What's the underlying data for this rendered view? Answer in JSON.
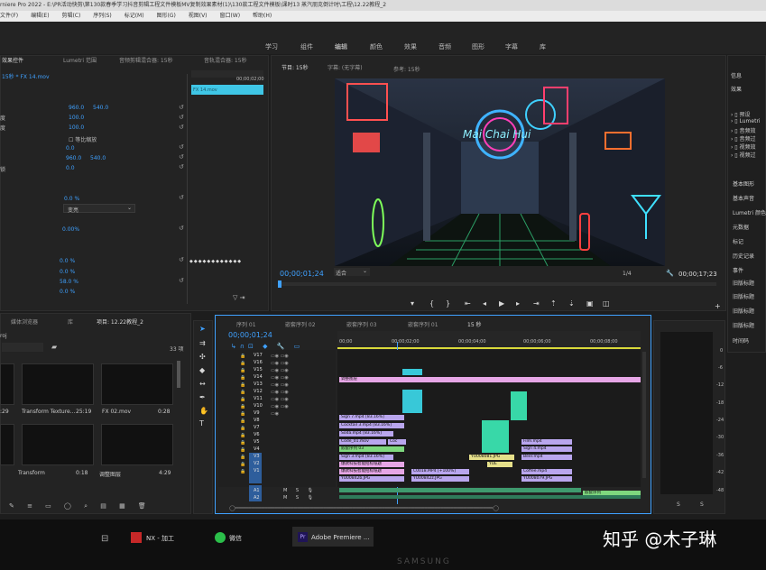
{
  "window": {
    "title": "rniere Pro 2022 - E:\\PR活动快剪\\第130款春季学习抖音剪辑工程文件模板MV复制效果素材(1)\\130款工程文件模板\\课时13 蒸汽朋克倒计时\\工程\\12.22教程_2",
    "menus": [
      "文件(F)",
      "编辑(E)",
      "剪辑(C)",
      "序列(S)",
      "标记(M)",
      "图形(G)",
      "视图(V)",
      "窗口(W)",
      "帮助(H)"
    ]
  },
  "workspaces": [
    "学习",
    "组件",
    "编辑",
    "颜色",
    "效果",
    "音频",
    "图形",
    "字幕",
    "库"
  ],
  "effect_controls": {
    "tabs": [
      "效果控件",
      "Lumetri 范围",
      "音频剪辑混合器: 15秒",
      "音轨混合器: 15秒"
    ],
    "clip": "15秒 * FX 14.mov",
    "mini_time": "00;00;02;00",
    "mini_clip": "FX 14.mov",
    "labels": [
      "度",
      "度",
      "等比缩放",
      "锁",
      ""
    ],
    "values": [
      {
        "a": "960.0",
        "b": "540.0"
      },
      {
        "a": "100.0",
        "b": ""
      },
      {
        "a": "100.0",
        "b": ""
      },
      {
        "a": "0.0",
        "b": ""
      },
      {
        "a": "960.0",
        "b": "540.0"
      },
      {
        "a": "0.0",
        "b": ""
      }
    ],
    "uniform_scale": "等比缩放",
    "pct1": "0.0 %",
    "blend_select": "变亮",
    "pct2": "0.00%",
    "pct3": "0.0 %",
    "pct4": "0.0 %",
    "pct5": "58.0 %",
    "pct6": "0.0 %"
  },
  "program": {
    "tabs": [
      "节目: 15秒",
      "字幕: (无字幕)",
      "参考: 15秒"
    ],
    "timecode": "00;00;01;24",
    "fit": "适合",
    "quality": "1/4",
    "duration": "00;00;17;23",
    "sign_text": "Mai Chai Hui"
  },
  "project": {
    "tabs": [
      "媒体浏览器",
      "库",
      "项目: 12.22教程_2"
    ],
    "name": "roj",
    "count": "33 项",
    "items": [
      {
        "name": "",
        "dur": ":29"
      },
      {
        "name": "Transform Texture...",
        "dur": "25:19"
      },
      {
        "name": "FX 02.mov",
        "dur": "0:28"
      },
      {
        "name": "",
        "dur": ""
      },
      {
        "name": "Transform",
        "dur": "0:18"
      },
      {
        "name": "调整图层",
        "dur": "4:29"
      }
    ]
  },
  "timeline": {
    "tabs": [
      "序列 01",
      "嵌套序列 02",
      "嵌套序列 03",
      "嵌套序列 01",
      "15 秒"
    ],
    "timecode": "00;00;01;24",
    "ruler": [
      "00;00",
      "00;00;02;00",
      "00;00;04;00",
      "00;00;06;00",
      "00;00;08;00"
    ],
    "video_tracks": [
      "V17",
      "V16",
      "V15",
      "V14",
      "V13",
      "V12",
      "V11",
      "V10",
      "V9",
      "V8",
      "V7",
      "V6",
      "V5",
      "V4",
      "V3",
      "V2",
      "V1"
    ],
    "audio_tracks": [
      "A1",
      "A2"
    ],
    "clips": [
      {
        "t": "调整图层",
        "c": "#e6a6e6"
      },
      {
        "t": "Sign 7.mp4 [83.16%]",
        "c": "#b9a6ee"
      },
      {
        "t": "Cocktail 3.mp4 [83.16%]",
        "c": "#b9a6ee"
      },
      {
        "t": "Soda.mp4 [83.16%]",
        "c": "#b9a6ee"
      },
      {
        "t": "Code_01.mov",
        "c": "#b9a6ee"
      },
      {
        "t": "Coc",
        "c": "#b9a6ee"
      },
      {
        "t": "嵌套序列 03",
        "c": "#7ed77e"
      },
      {
        "t": "Sign 3.mp4 [83.16%]",
        "c": "#b9a6ee"
      },
      {
        "t": "爆款科技智能招标纸题",
        "c": "#e6a6e6"
      },
      {
        "t": "爆款科技智能招标纸题",
        "c": "#e6a6e6"
      },
      {
        "t": "YU00842b.JPG",
        "c": "#b9a6ee"
      },
      {
        "t": "C0018.MP4 [+100%]",
        "c": "#b9a6ee"
      },
      {
        "t": "YU00842z.JPG",
        "c": "#b9a6ee"
      },
      {
        "t": "Film.mp4",
        "c": "#b9a6ee"
      },
      {
        "t": "Sign 4.mp4",
        "c": "#b9a6ee"
      },
      {
        "t": "Beer.mp4",
        "c": "#b9a6ee"
      },
      {
        "t": "YU008081.JPG",
        "c": "#e6e08a"
      },
      {
        "t": "YUE",
        "c": "#e6e08a"
      },
      {
        "t": "Coffee.mp4",
        "c": "#b9a6ee"
      },
      {
        "t": "YU008079.JPG",
        "c": "#b9a6ee"
      },
      {
        "t": "嵌套序列",
        "c": "#7ed77e"
      }
    ],
    "meter_ticks": [
      "0",
      "-6",
      "-12",
      "-18",
      "-24",
      "-30",
      "-36",
      "-42",
      "-48"
    ],
    "meter_labels": [
      "S",
      "S"
    ]
  },
  "right_panel": {
    "top": [
      "信息",
      "效果"
    ],
    "tree": [
      "预设",
      "Lumetri",
      "音频效",
      "音频过",
      "视频效",
      "视频过"
    ],
    "items": [
      "基本图形",
      "基本声音",
      "Lumetri 颜色",
      "元数据",
      "标记",
      "历史记录",
      "事件",
      "旧版标题",
      "旧版标题",
      "旧版标题",
      "旧版标题",
      "时间码"
    ]
  },
  "taskbar": {
    "items": [
      "NX - 加工",
      "微信",
      "Adobe Premiere ..."
    ],
    "brand": "SAMSUNG"
  },
  "watermark": "知乎 @木子琳"
}
